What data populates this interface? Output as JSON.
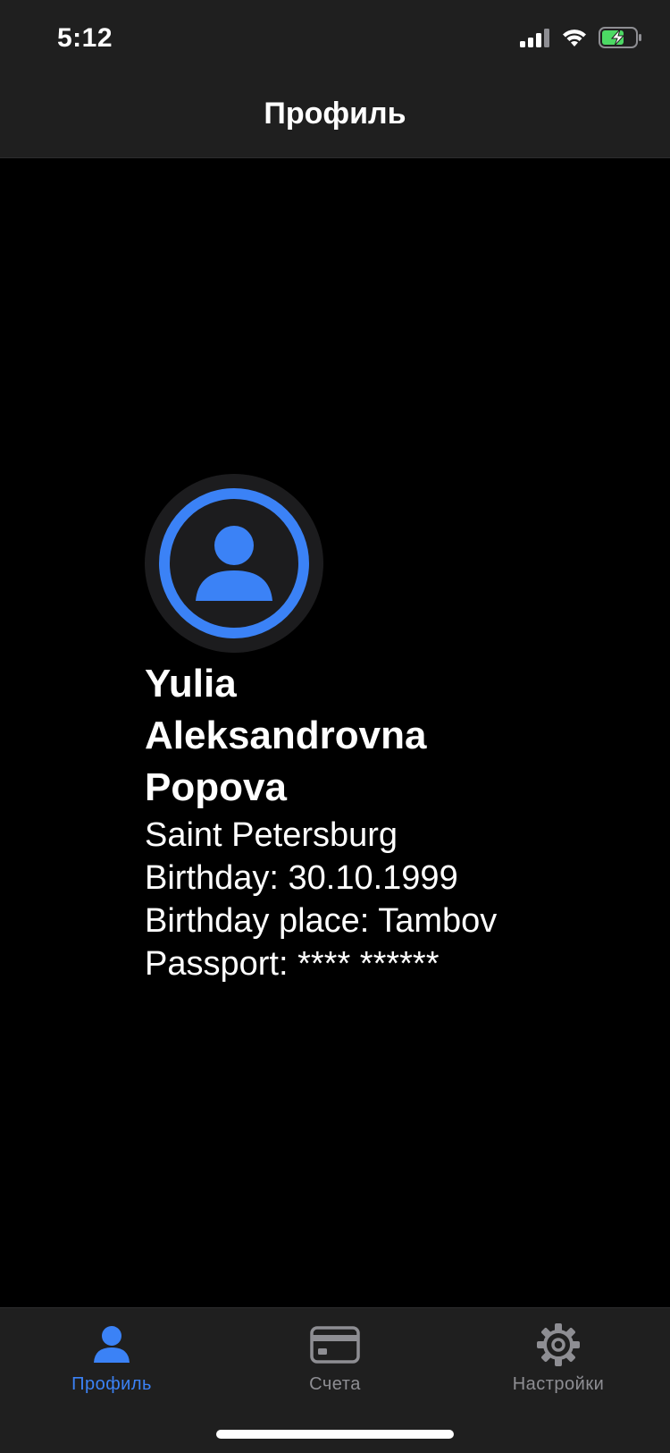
{
  "status_bar": {
    "time": "5:12",
    "icons": [
      "signal-icon",
      "wifi-icon",
      "battery-charging-icon"
    ]
  },
  "header": {
    "title": "Профиль"
  },
  "profile": {
    "name_lines": [
      "Yulia",
      "Aleksandrovna",
      "Popova"
    ],
    "city": "Saint Petersburg",
    "birthday": "Birthday: 30.10.1999",
    "birthday_place": "Birthday place: Tambov",
    "passport": "Passport: **** ******"
  },
  "tabs": [
    {
      "label": "Профиль",
      "icon": "person-icon",
      "active": true
    },
    {
      "label": "Счета",
      "icon": "card-icon",
      "active": false
    },
    {
      "label": "Настройки",
      "icon": "gear-icon",
      "active": false
    }
  ],
  "colors": {
    "accent": "#3b82f6",
    "bar_background": "#1f1f1f",
    "background": "#000000",
    "inactive": "#8e8e93",
    "battery_green": "#4cd964"
  }
}
